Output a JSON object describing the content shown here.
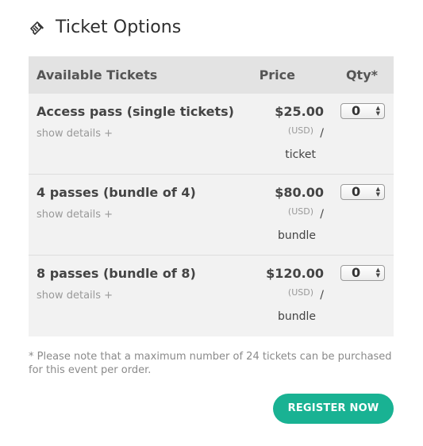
{
  "header": {
    "icon": "ticket-icon",
    "title": "Ticket Options"
  },
  "table": {
    "columns": {
      "name": "Available Tickets",
      "price": "Price",
      "qty": "Qty*"
    },
    "rows": [
      {
        "name": "Access pass (single tickets)",
        "details": "show details +",
        "price": "$25.00",
        "currency": "(USD)",
        "slash": "/",
        "unit": "ticket",
        "qty": "0"
      },
      {
        "name": "4 passes (bundle of 4)",
        "details": "show details +",
        "price": "$80.00",
        "currency": "(USD)",
        "slash": "/",
        "unit": "bundle",
        "qty": "0"
      },
      {
        "name": "8 passes (bundle of 8)",
        "details": "show details +",
        "price": "$120.00",
        "currency": "(USD)",
        "slash": "/",
        "unit": "bundle",
        "qty": "0"
      }
    ]
  },
  "note": "* Please note that a maximum number of 24 tickets can be purchased for this event per order.",
  "register_button": "REGISTER NOW",
  "colors": {
    "accent": "#19b293",
    "header_bg": "#e3e3e3",
    "table_bg": "#f2f2f2"
  }
}
